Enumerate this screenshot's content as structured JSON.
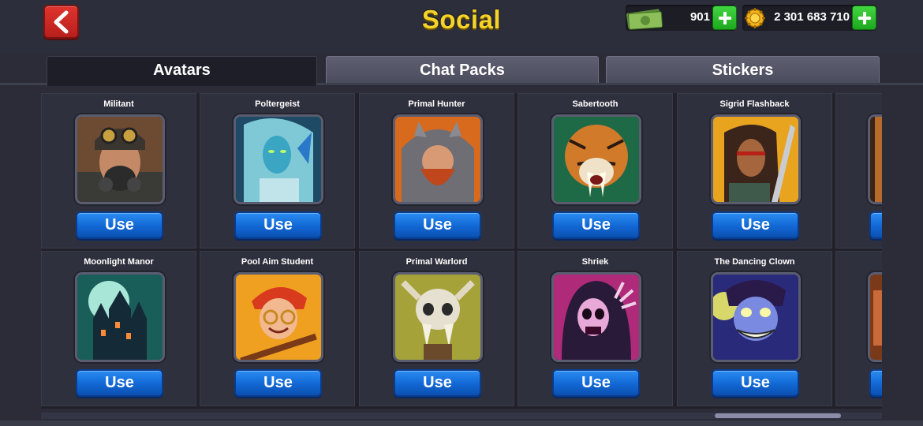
{
  "header": {
    "title": "Social",
    "cash": {
      "value": "901",
      "icon": "cash-icon"
    },
    "coins": {
      "value": "2 301 683 710",
      "icon": "coin-icon"
    }
  },
  "tabs": [
    {
      "label": "Avatars",
      "active": true
    },
    {
      "label": "Chat Packs",
      "active": false
    },
    {
      "label": "Stickers",
      "active": false
    }
  ],
  "avatars": [
    {
      "name": "Militant",
      "button": "Use"
    },
    {
      "name": "Poltergeist",
      "button": "Use"
    },
    {
      "name": "Primal Hunter",
      "button": "Use"
    },
    {
      "name": "Sabertooth",
      "button": "Use"
    },
    {
      "name": "Sigrid Flashback",
      "button": "Use"
    },
    {
      "name": "Moonlight Manor",
      "button": "Use"
    },
    {
      "name": "Pool Aim Student",
      "button": "Use"
    },
    {
      "name": "Primal Warlord",
      "button": "Use"
    },
    {
      "name": "Shriek",
      "button": "Use"
    },
    {
      "name": "The Dancing Clown",
      "button": "Use"
    }
  ],
  "colors": {
    "title": "#f5d32a",
    "use_button": "#1267d4",
    "plus_button": "#1ea81e",
    "back_button": "#d22a26"
  }
}
